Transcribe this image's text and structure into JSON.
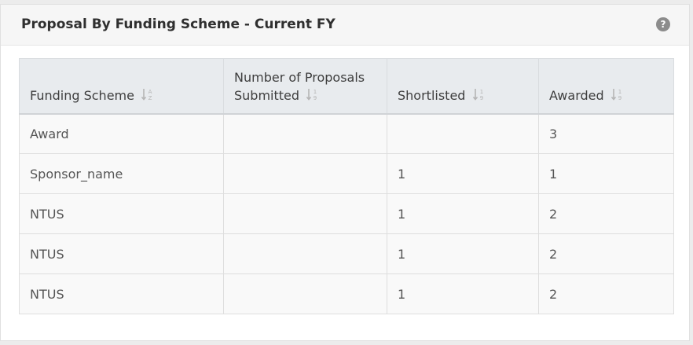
{
  "panel": {
    "title": "Proposal By Funding Scheme - Current FY",
    "help_icon": "question-circle-icon"
  },
  "table": {
    "headers": [
      {
        "label": "Funding Scheme",
        "sort_icon": "sort-alpha-icon"
      },
      {
        "label": "Number of Proposals Submitted",
        "sort_icon": "sort-numeric-icon"
      },
      {
        "label": "Shortlisted",
        "sort_icon": "sort-numeric-icon"
      },
      {
        "label": "Awarded",
        "sort_icon": "sort-numeric-icon"
      }
    ],
    "rows": [
      [
        "Award",
        "",
        "",
        "3"
      ],
      [
        "Sponsor_name",
        "",
        "1",
        "1"
      ],
      [
        "NTUS",
        "",
        "1",
        "2"
      ],
      [
        "NTUS",
        "",
        "1",
        "2"
      ],
      [
        "NTUS",
        "",
        "1",
        "2"
      ]
    ]
  }
}
